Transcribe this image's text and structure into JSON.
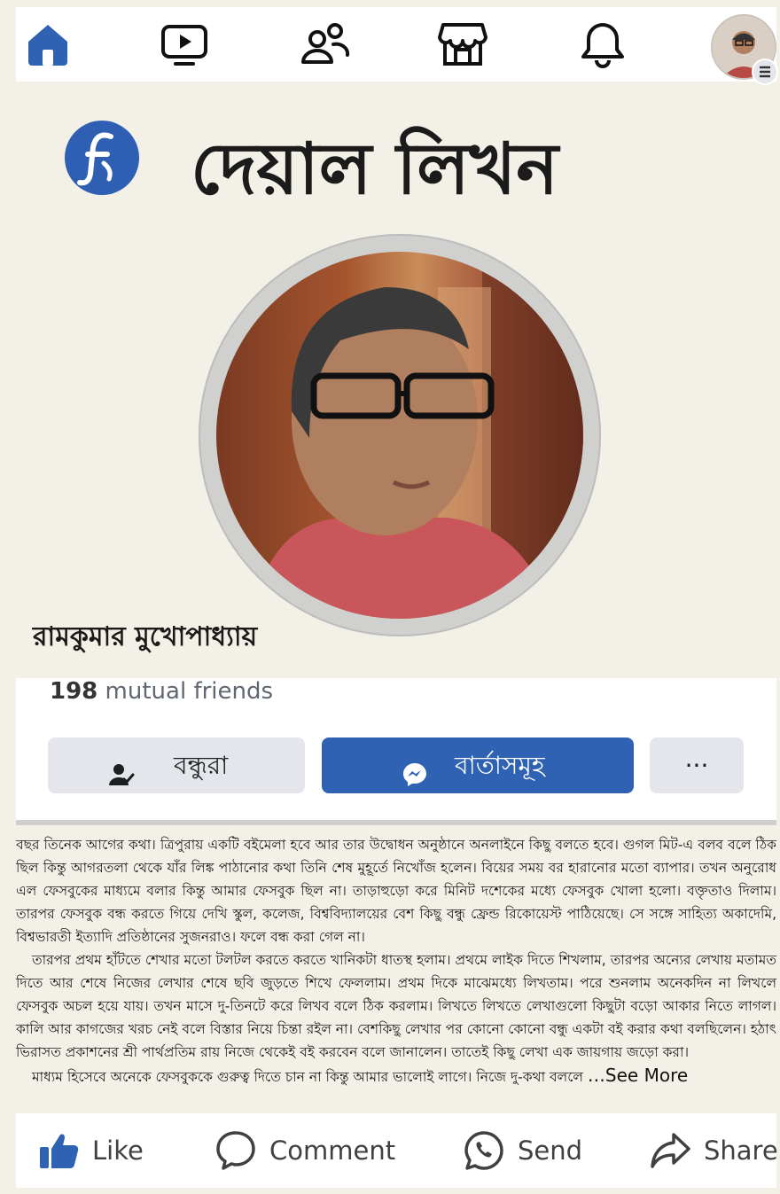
{
  "topnav": {
    "items": [
      {
        "name": "home-icon",
        "active": true
      },
      {
        "name": "video-icon"
      },
      {
        "name": "friends-icon"
      },
      {
        "name": "marketplace-icon"
      },
      {
        "name": "notifications-bell-icon"
      },
      {
        "name": "profile-avatar"
      }
    ],
    "accent": "#2f62b3"
  },
  "banner": {
    "title": "দেয়াল লিখন",
    "logo_icon": "f-logo-icon"
  },
  "profile": {
    "name": "রামকুমার মুখোপাধ্যায়",
    "mutual_count": "198",
    "mutual_label": "mutual friends"
  },
  "buttons": {
    "friends": "বন্ধুরা",
    "message": "বার্তাসমূহ",
    "more": "···"
  },
  "post": {
    "p1": "বছর তিনেক আগের কথা। ত্রিপুরায় একটি বইমেলা হবে আর তার উদ্বোধন অনুষ্ঠানে অনলাইনে কিছু বলতে হবে। গুগল মিট-এ বলব বলে ঠিক ছিল কিন্তু আগরতলা থেকে যাঁর লিঙ্ক পাঠানোর কথা তিনি শেষ মুহূর্তে নিখোঁজ হলেন। বিয়ের সময় বর হারানোর মতো ব্যাপার। তখন অনুরোধ এল ফেসবুকের মাধ্যমে বলার কিন্তু আমার ফেসবুক ছিল না। তাড়াহুড়ো করে মিনিট দশেকের মধ্যে ফেসবুক খোলা হলো। বক্তৃতাও দিলাম। তারপর ফেসবুক বন্ধ করতে গিয়ে দেখি স্কুল, কলেজ, বিশ্ববিদ্যালয়ের বেশ কিছু বন্ধু ফ্রেন্ড রিকোয়েস্ট পাঠিয়েছে। সে সঙ্গে সাহিত্য অকাদেমি, বিশ্বভারতী ইত্যাদি প্রতিষ্ঠানের সুজনরাও। ফলে বন্ধ করা গেল না।",
    "p2": "তারপর প্রথম হাঁটতে শেখার মতো টলটল করতে করতে খানিকটা ধাতস্থ হলাম। প্রথমে লাইক দিতে শিখলাম, তারপর অন্যের লেখায় মতামত দিতে আর শেষে নিজের লেখার শেষে ছবি জুড়তে শিখে ফেললাম। প্রথম দিকে মাঝেমধ্যে লিখতাম। পরে শুনলাম অনেকদিন না লিখলে ফেসবুক অচল হয়ে যায়। তখন মাসে দু-তিনটে করে লিখব বলে ঠিক করলাম। লিখতে লিখতে লেখাগুলো কিছুটা বড়ো আকার নিতে লাগল। কালি আর কাগজের খরচ নেই বলে বিস্তার নিয়ে চিন্তা রইল না। বেশকিছু লেখার পর কোনো কোনো বন্ধু একটা বই করার কথা বলছিলেন। হঠাৎ ভিরাসত প্রকাশনের শ্রী পার্থপ্রতিম রায় নিজে থেকেই বই করবেন বলে জানালেন। তাতেই কিছু লেখা এক জায়গায় জড়ো করা।",
    "p3": "মাধ্যম হিসেবে অনেকে ফেসবুককে গুরুত্ব দিতে চান না কিন্তু আমার ভালোই লাগে। নিজে দু-কথা বললে",
    "see_more": "…See More"
  },
  "actions": {
    "like": "Like",
    "comment": "Comment",
    "send": "Send",
    "share": "Share"
  }
}
